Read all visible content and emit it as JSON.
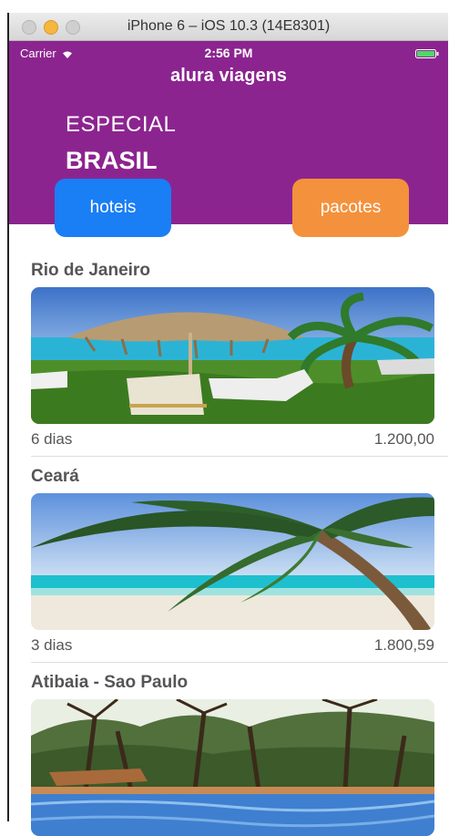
{
  "window": {
    "title": "iPhone 6 – iOS 10.3 (14E8301)"
  },
  "status_bar": {
    "carrier": "Carrier",
    "time": "2:56 PM"
  },
  "header": {
    "app_title": "alura viagens",
    "special_label": "ESPECIAL",
    "country_label": "BRASIL"
  },
  "buttons": {
    "hotels": "hoteis",
    "packages": "pacotes"
  },
  "colors": {
    "header": "#8c2490",
    "hotels_button": "#1a7ef5",
    "packages_button": "#f4913c"
  },
  "trips": [
    {
      "title": "Rio de Janeiro",
      "days": "6 dias",
      "price": "1.200,00",
      "image": "pool-umbrella-photo"
    },
    {
      "title": "Ceará",
      "days": "3 dias",
      "price": "1.800,59",
      "image": "beach-palm-photo"
    },
    {
      "title": "Atibaia - Sao Paulo",
      "image": "forest-pool-photo"
    }
  ]
}
